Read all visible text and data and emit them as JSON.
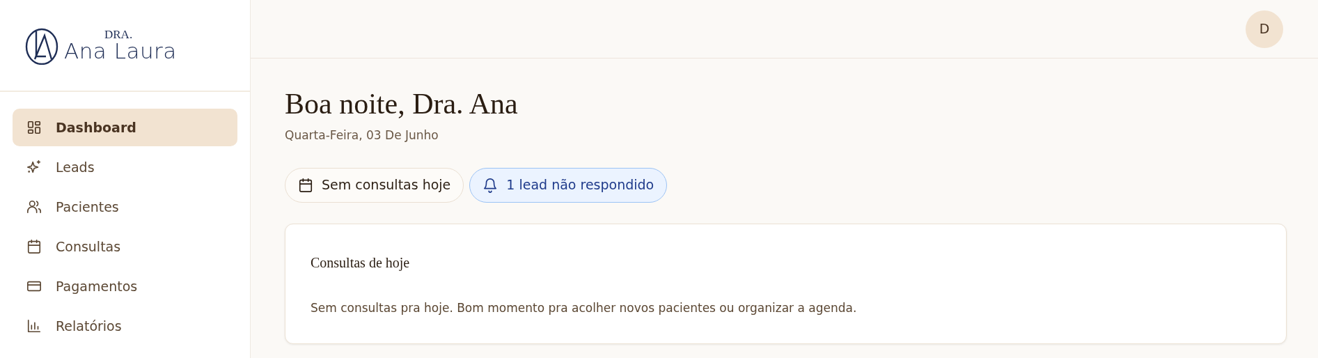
{
  "brand": {
    "prefix": "DRA.",
    "name": "Ana Laura"
  },
  "nav": [
    {
      "label": "Dashboard",
      "selected": true
    },
    {
      "label": "Leads",
      "selected": false
    },
    {
      "label": "Pacientes",
      "selected": false
    },
    {
      "label": "Consultas",
      "selected": false
    },
    {
      "label": "Pagamentos",
      "selected": false
    },
    {
      "label": "Relatórios",
      "selected": false
    }
  ],
  "avatar": "D",
  "greeting": "Boa noite, Dra. Ana",
  "date": "Quarta-Feira, 03 De Junho",
  "chips": [
    {
      "kind": "neutral",
      "label": "Sem consultas hoje"
    },
    {
      "kind": "info",
      "label": "1 lead não respondido"
    }
  ],
  "card": {
    "title": "Consultas de hoje",
    "text": "Sem consultas pra hoje. Bom momento pra acolher novos pacientes ou organizar a agenda."
  }
}
